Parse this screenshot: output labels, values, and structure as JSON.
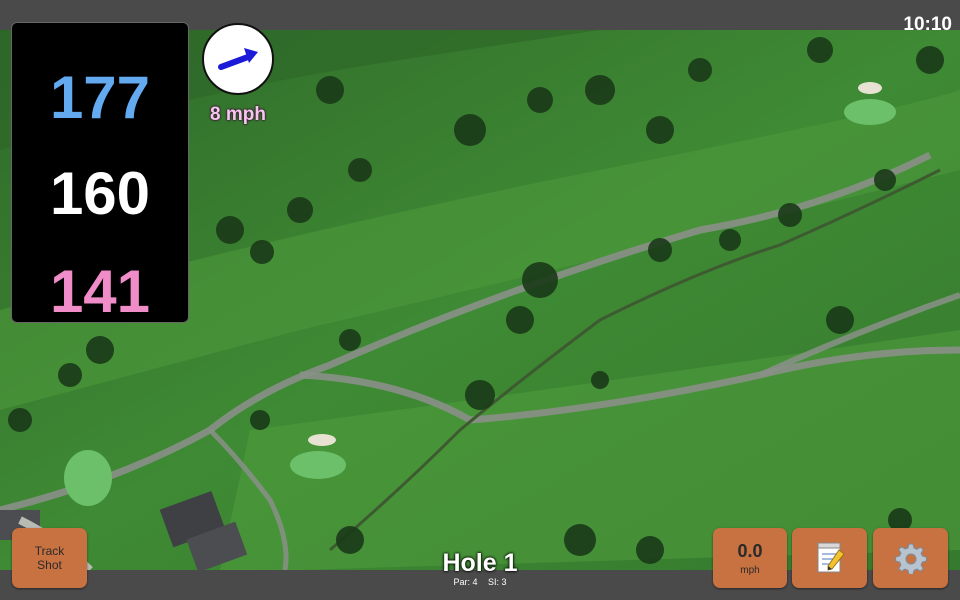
{
  "status_bar": {
    "time": "10:10"
  },
  "yardages": {
    "back": "177",
    "center": "160",
    "front": "141"
  },
  "wind": {
    "speed_label": "8 mph"
  },
  "hole": {
    "title": "Hole 1",
    "par": "Par: 4",
    "stroke_index": "SI: 3"
  },
  "buttons": {
    "track_shot_line1": "Track",
    "track_shot_line2": "Shot",
    "wind_value": "0.0",
    "wind_unit": "mph",
    "notes_icon": "notepad-icon",
    "settings_icon": "gear-icon"
  },
  "colors": {
    "back_yardage": "#64aaf0",
    "center_yardage": "#ffffff",
    "front_yardage": "#f08cc8",
    "button": "#c87141",
    "wind_arrow": "#1a1ad8"
  }
}
